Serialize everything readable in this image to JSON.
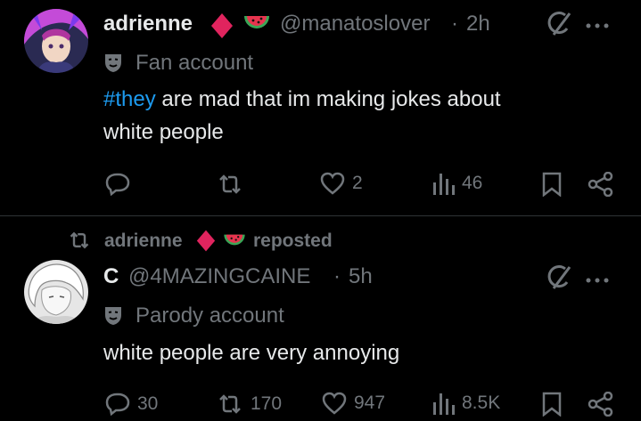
{
  "post1": {
    "display_name": "adrienne",
    "handle": "@manatoslover",
    "separator": "·",
    "time": "2h",
    "account_label": "Fan account",
    "hashtag": "#they",
    "text_rest": " are mad that im making jokes about",
    "text_line2": "white people",
    "actions": {
      "replies": "",
      "reposts": "",
      "likes": "2",
      "views": "46"
    }
  },
  "repost_banner": {
    "name": "adrienne",
    "action": "reposted"
  },
  "post2": {
    "display_name": "C",
    "handle": "@4MAZINGCAINE",
    "separator": "·",
    "time": "5h",
    "account_label": "Parody account",
    "text": "white people are very annoying",
    "actions": {
      "replies": "30",
      "reposts": "170",
      "likes": "947",
      "views": "8.5K"
    }
  },
  "colors": {
    "background": "#000000",
    "text_primary": "#e7e9ea",
    "text_secondary": "#71767b",
    "link": "#1d9bf0",
    "divider": "#2f3336",
    "diamond": "#e0245e"
  },
  "icons": [
    "diamond-icon",
    "watermelon-icon",
    "grok-icon",
    "more-icon",
    "mask-icon",
    "reply-icon",
    "repost-icon",
    "like-icon",
    "views-icon",
    "bookmark-icon",
    "share-icon"
  ]
}
